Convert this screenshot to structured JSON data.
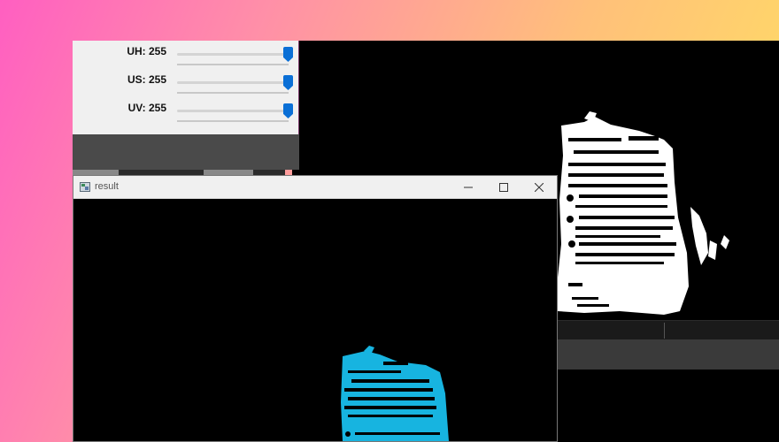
{
  "trackbars": [
    {
      "label": "UH: 255",
      "value": 255,
      "max": 255
    },
    {
      "label": "US: 255",
      "value": 255,
      "max": 255
    },
    {
      "label": "UV: 255",
      "value": 255,
      "max": 255
    }
  ],
  "result_window": {
    "title": "result",
    "minimize_icon": "minimize-icon",
    "maximize_icon": "maximize-icon",
    "close_icon": "close-icon"
  },
  "colors": {
    "accent": "#0a6fd6",
    "mask_fill": "#ffffff",
    "result_fill": "#17b4e0",
    "background_gradient": [
      "#ff5fc1",
      "#ffe45e"
    ]
  }
}
